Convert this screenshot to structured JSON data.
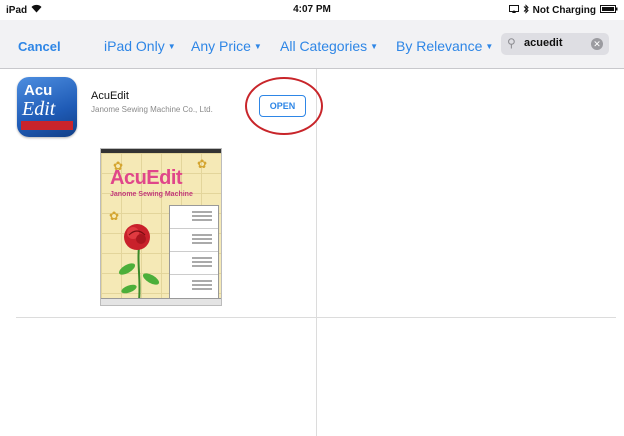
{
  "status": {
    "device": "iPad",
    "time": "4:07 PM",
    "charging": "Not Charging"
  },
  "nav": {
    "cancel": "Cancel",
    "filters": [
      {
        "label": "iPad Only"
      },
      {
        "label": "Any Price"
      },
      {
        "label": "All Categories"
      },
      {
        "label": "By Relevance"
      }
    ],
    "search_value": "acuedit"
  },
  "result": {
    "icon_top": "Acu",
    "icon_bottom": "Edit",
    "name": "AcuEdit",
    "developer": "Janome Sewing Machine Co., Ltd.",
    "button": "OPEN"
  },
  "screenshot": {
    "title": "AcuEdit",
    "subtitle": "Janome Sewing Machine"
  },
  "colors": {
    "accent": "#2e86e6",
    "highlight": "#c8252a"
  }
}
